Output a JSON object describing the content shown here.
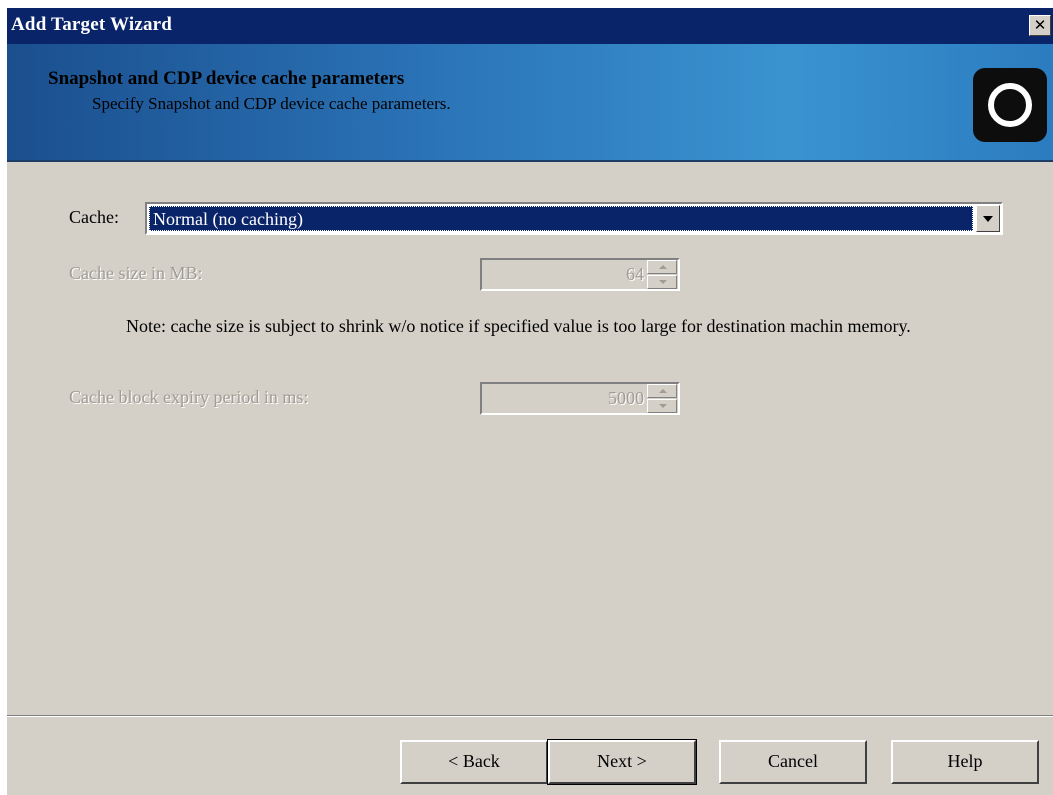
{
  "window": {
    "title": "Add Target Wizard",
    "close_label": "✕"
  },
  "header": {
    "title": "Snapshot and CDP device cache parameters",
    "subtitle": "Specify Snapshot and CDP device cache parameters.",
    "icon": "target-ring-icon"
  },
  "form": {
    "cache_label": "Cache:",
    "cache_value": "Normal (no caching)",
    "cache_size_label": "Cache size in MB:",
    "cache_size_value": "64",
    "note": "Note: cache size is subject to shrink w/o notice if specified value is too large for destination machin memory.",
    "expiry_label": "Cache block expiry period in ms:",
    "expiry_value": "5000"
  },
  "buttons": {
    "back": "< Back",
    "next": "Next >",
    "cancel": "Cancel",
    "help": "Help"
  },
  "colors": {
    "titlebar": "#0a246a",
    "dialog_bg": "#d4d0c8",
    "selection": "#0a246a",
    "disabled_text": "#a09c94"
  }
}
